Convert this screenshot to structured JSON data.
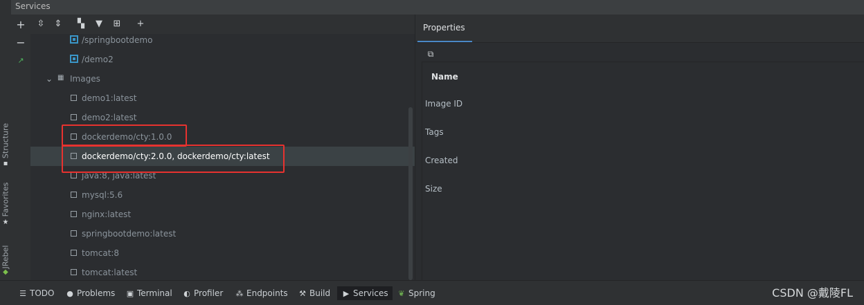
{
  "window": {
    "title": "Services"
  },
  "left_stripe": {
    "labels": [
      "Structure",
      "Favorites",
      "JRebel"
    ]
  },
  "toolbar": {
    "icons": [
      "add-icon",
      "expand-all-icon",
      "collapse-all-icon",
      "group-icon",
      "filter-icon",
      "new-tab-icon",
      "add-service-icon"
    ]
  },
  "tree": {
    "containers": [
      "/springbootdemo",
      "/demo2"
    ],
    "images_group": "Images",
    "images": [
      "demo1:latest",
      "demo2:latest",
      "dockerdemo/cty:1.0.0",
      "dockerdemo/cty:2.0.0, dockerdemo/cty:latest",
      "java:8, java:latest",
      "mysql:5.6",
      "nginx:latest",
      "springbootdemo:latest",
      "tomcat:8",
      "tomcat:latest"
    ],
    "selected_index": 3,
    "highlighted_indices": [
      2,
      3
    ],
    "highlight_color": "#e8322f"
  },
  "properties": {
    "tab": "Properties",
    "header": "Name",
    "rows": [
      "Image ID",
      "Tags",
      "Created",
      "Size"
    ]
  },
  "bottom_bar": {
    "tabs": [
      {
        "label": "TODO",
        "icon": "list-icon"
      },
      {
        "label": "Problems",
        "icon": "problems-icon"
      },
      {
        "label": "Terminal",
        "icon": "terminal-icon"
      },
      {
        "label": "Profiler",
        "icon": "profiler-icon"
      },
      {
        "label": "Endpoints",
        "icon": "endpoints-icon"
      },
      {
        "label": "Build",
        "icon": "hammer-icon"
      },
      {
        "label": "Services",
        "icon": "play-icon"
      },
      {
        "label": "Spring",
        "icon": "spring-icon"
      }
    ],
    "active": "Services"
  },
  "watermark": "CSDN @戴陵FL",
  "colors": {
    "accent": "#4a88c7",
    "selection": "#3b4245",
    "container_icon": "#3a96c8"
  }
}
